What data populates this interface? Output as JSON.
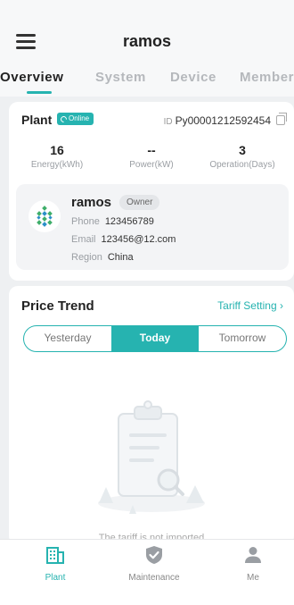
{
  "header": {
    "title": "ramos",
    "menu_icon": "hamburger-menu-icon"
  },
  "tabs": [
    {
      "label": "Overview",
      "active": true
    },
    {
      "label": "System",
      "active": false
    },
    {
      "label": "Device",
      "active": false
    },
    {
      "label": "Member",
      "active": false
    }
  ],
  "plant": {
    "label": "Plant",
    "status": "Online",
    "id_key": "ID",
    "id_value": "Py00001212592454",
    "stats": [
      {
        "value": "16",
        "label": "Energy(kWh)"
      },
      {
        "value": "--",
        "label": "Power(kW)"
      },
      {
        "value": "3",
        "label": "Operation(Days)"
      }
    ],
    "owner": {
      "name": "ramos",
      "role": "Owner",
      "phone_key": "Phone",
      "phone": "123456789",
      "email_key": "Email",
      "email": "123456@12.com",
      "region_key": "Region",
      "region": "China"
    }
  },
  "price_trend": {
    "title": "Price Trend",
    "tariff_link": "Tariff Setting",
    "segments": [
      {
        "label": "Yesterday",
        "active": false
      },
      {
        "label": "Today",
        "active": true
      },
      {
        "label": "Tomorrow",
        "active": false
      }
    ],
    "empty_text": "The tariff is not imported"
  },
  "bottom_nav": [
    {
      "label": "Plant",
      "icon": "building-icon",
      "active": true
    },
    {
      "label": "Maintenance",
      "icon": "shield-check-icon",
      "active": false
    },
    {
      "label": "Me",
      "icon": "person-icon",
      "active": false
    }
  ],
  "colors": {
    "accent": "#26b3b0",
    "background": "#eef0f2",
    "card": "#ffffff"
  }
}
